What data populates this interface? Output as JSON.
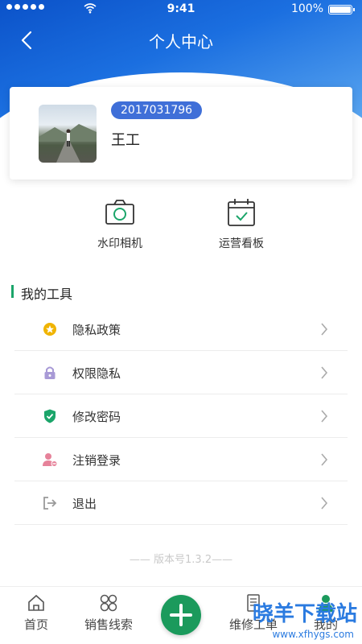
{
  "status_bar": {
    "time": "9:41",
    "battery": "100%"
  },
  "header": {
    "title": "个人中心"
  },
  "profile": {
    "user_id": "2017031796",
    "name": "王工"
  },
  "quick_actions": [
    {
      "label": "水印相机",
      "icon": "camera-icon"
    },
    {
      "label": "运营看板",
      "icon": "calendar-check-icon"
    }
  ],
  "section": {
    "title": "我的工具"
  },
  "menu": [
    {
      "label": "隐私政策",
      "icon": "star-coin-icon",
      "color": "#f0b400"
    },
    {
      "label": "权限隐私",
      "icon": "lock-icon",
      "color": "#a89ad6"
    },
    {
      "label": "修改密码",
      "icon": "shield-check-icon",
      "color": "#1ba56a"
    },
    {
      "label": "注销登录",
      "icon": "user-remove-icon",
      "color": "#e6829a"
    },
    {
      "label": "退出",
      "icon": "logout-icon",
      "color": "#999999"
    }
  ],
  "version": "—— 版本号1.3.2——",
  "tabs": [
    {
      "label": "首页",
      "icon": "home-icon"
    },
    {
      "label": "销售线索",
      "icon": "grid-clover-icon"
    },
    {
      "label": "",
      "icon": "plus-icon"
    },
    {
      "label": "维修工单",
      "icon": "document-icon"
    },
    {
      "label": "我的",
      "icon": "person-icon"
    }
  ],
  "watermark": {
    "text": "晓羊下载站",
    "url": "www.xfhygs.com"
  },
  "colors": {
    "primary": "#1b6fe0",
    "accent": "#1b9a5c",
    "badge": "#3f6fd8"
  }
}
